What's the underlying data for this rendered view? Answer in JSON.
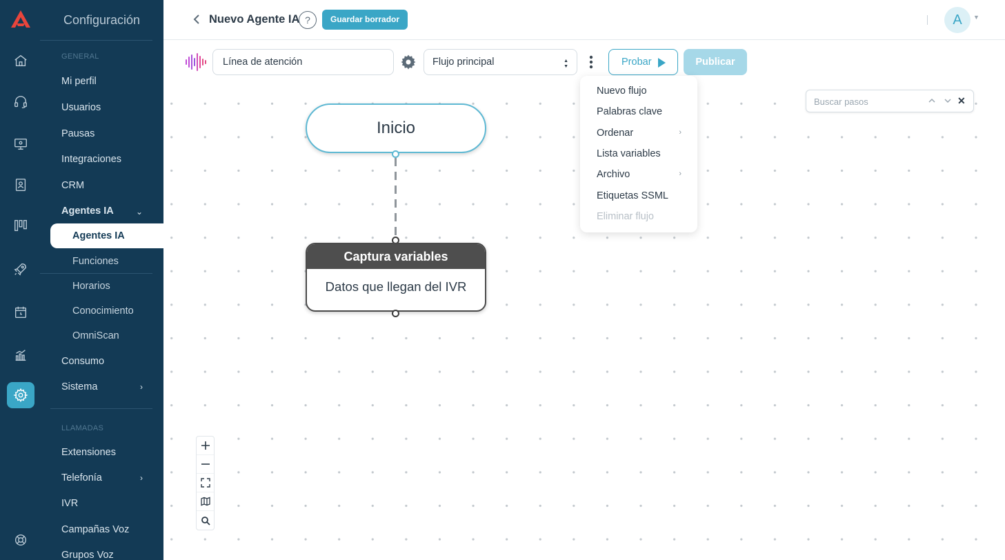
{
  "app": {
    "accent": "#3aa6c6",
    "sidebar_bg": "#133a55"
  },
  "rail": {
    "items": [
      {
        "icon": "home-icon"
      },
      {
        "icon": "headset-icon"
      },
      {
        "icon": "monitor-icon"
      },
      {
        "icon": "contacts-book-icon"
      },
      {
        "icon": "kanban-icon"
      },
      {
        "icon": "rocket-icon"
      },
      {
        "icon": "calendar-icon"
      },
      {
        "icon": "analytics-icon"
      },
      {
        "icon": "settings-gear-icon",
        "active": true
      },
      {
        "icon": "lifebuoy-icon"
      }
    ]
  },
  "sidebar": {
    "title": "Configuración",
    "section_general": "GENERAL",
    "items": {
      "mi_perfil": "Mi perfil",
      "usuarios": "Usuarios",
      "pausas": "Pausas",
      "integraciones": "Integraciones",
      "crm": "CRM",
      "agentes_ia": "Agentes IA",
      "consumo": "Consumo",
      "sistema": "Sistema"
    },
    "agentes_ia_sub": {
      "agentes_ia": "Agentes IA",
      "funciones": "Funciones",
      "horarios": "Horarios",
      "conocimiento": "Conocimiento",
      "omniscan": "OmniScan"
    },
    "section_llamadas": "LLAMADAS",
    "llamadas_items": {
      "extensiones": "Extensiones",
      "telefonia": "Telefonía",
      "ivr": "IVR",
      "campanas_voz": "Campañas Voz",
      "grupos_voz": "Grupos Voz"
    }
  },
  "header": {
    "title": "Nuevo Agente IA",
    "help": "?",
    "save_draft": "Guardar borrador",
    "avatar_initial": "A"
  },
  "toolbar": {
    "flow_name": "Línea de atención",
    "flow_select_value": "Flujo principal",
    "probar": "Probar",
    "publicar": "Publicar"
  },
  "menu": {
    "items": {
      "nuevo_flujo": "Nuevo flujo",
      "palabras_clave": "Palabras clave",
      "ordenar": "Ordenar",
      "lista_variables": "Lista variables",
      "archivo": "Archivo",
      "etiquetas_ssml": "Etiquetas SSML",
      "eliminar_flujo": "Eliminar flujo"
    }
  },
  "canvas": {
    "start_node": "Inicio",
    "capture_node": {
      "title": "Captura variables",
      "body": "Datos que llegan del IVR"
    },
    "search_placeholder": "Buscar pasos"
  }
}
